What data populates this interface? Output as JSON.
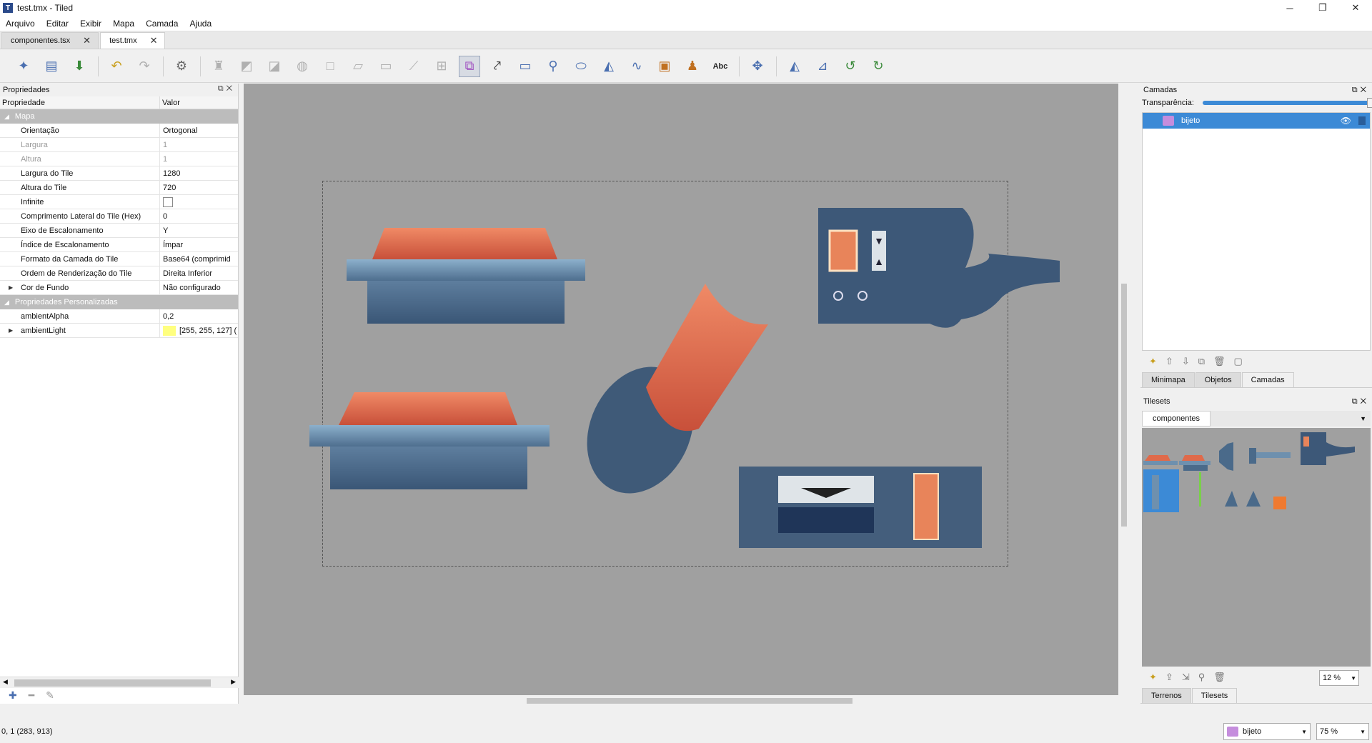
{
  "window": {
    "title": "test.tmx - Tiled"
  },
  "menu": [
    "Arquivo",
    "Editar",
    "Exibir",
    "Mapa",
    "Camada",
    "Ajuda"
  ],
  "tabs": [
    {
      "label": "componentes.tsx",
      "active": false
    },
    {
      "label": "test.tmx",
      "active": true
    }
  ],
  "toolbar": {
    "icons": [
      "new-file-icon",
      "open-file-icon",
      "save-icon",
      "undo-icon",
      "redo-icon",
      "command-gear-icon",
      "stamp-brush-icon",
      "terrain-brush-icon",
      "wang-brush-icon",
      "bucket-fill-icon",
      "shape-fill-icon",
      "eraser-icon",
      "rect-select-icon",
      "magic-wand-icon",
      "select-same-tile-icon",
      "select-objects-icon",
      "edit-polygons-icon",
      "insert-rectangle-icon",
      "insert-point-icon",
      "insert-ellipse-icon",
      "insert-polygon-icon",
      "insert-polyline-icon",
      "insert-tile-icon",
      "insert-template-icon",
      "insert-text-icon",
      "move-icon",
      "flip-horizontal-icon",
      "flip-vertical-icon",
      "rotate-left-icon",
      "rotate-right-icon"
    ],
    "text_tool_label": "Abc"
  },
  "properties": {
    "title": "Propriedades",
    "col_property": "Propriedade",
    "col_value": "Valor",
    "group_map": "Mapa",
    "group_custom": "Propriedades Personalizadas",
    "rows": [
      {
        "k": "Orientação",
        "v": "Ortogonal"
      },
      {
        "k": "Largura",
        "v": "1"
      },
      {
        "k": "Altura",
        "v": "1"
      },
      {
        "k": "Largura do Tile",
        "v": "1280"
      },
      {
        "k": "Altura do Tile",
        "v": "720"
      },
      {
        "k": "Infinite",
        "v": ""
      },
      {
        "k": "Comprimento Lateral do Tile (Hex)",
        "v": "0"
      },
      {
        "k": "Eixo de Escalonamento",
        "v": "Y"
      },
      {
        "k": "Índice de Escalonamento",
        "v": "Ímpar"
      },
      {
        "k": "Formato da Camada do Tile",
        "v": "Base64 (comprimid"
      },
      {
        "k": "Ordem de Renderização do Tile",
        "v": "Direita Inferior"
      },
      {
        "k": "Cor de Fundo",
        "v": "Não configurado"
      }
    ],
    "custom_rows": [
      {
        "k": "ambientAlpha",
        "v": "0,2"
      },
      {
        "k": "ambientLight",
        "v": "[255, 255, 127] ("
      }
    ],
    "ambient_color": "#ffff7f"
  },
  "layers": {
    "title": "Camadas",
    "opacity_label": "Transparência:",
    "opacity": 1.0,
    "items": [
      {
        "name": "bijeto",
        "selected": true
      }
    ]
  },
  "dock_tabs_top": [
    "Minimapa",
    "Objetos",
    "Camadas"
  ],
  "tilesets": {
    "title": "Tilesets",
    "tab": "componentes",
    "zoom": "12 %"
  },
  "dock_tabs_bottom": [
    "Terrenos",
    "Tilesets"
  ],
  "status": {
    "coords": "0, 1 (283, 913)",
    "layer": "bijeto",
    "zoom": "75 %"
  },
  "colors": {
    "accent": "#3c8ad6",
    "canvas_bg": "#a0a0a0",
    "orange": "#e8704a",
    "steel_blue": "#4a6a8a"
  }
}
